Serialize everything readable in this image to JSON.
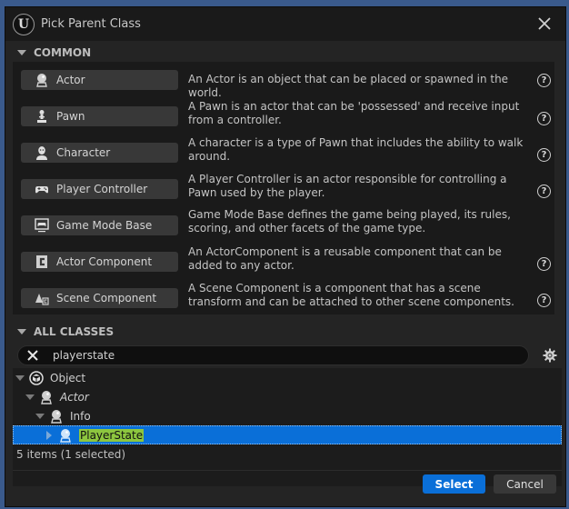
{
  "window": {
    "title": "Pick Parent Class",
    "close_icon": "close-icon"
  },
  "common": {
    "header": "COMMON",
    "items": [
      {
        "label": "Actor",
        "icon": "actor-icon",
        "description": "An Actor is an object that can be placed or spawned in the world.",
        "has_help": true
      },
      {
        "label": "Pawn",
        "icon": "pawn-icon",
        "description": "A Pawn is an actor that can be 'possessed' and receive input from a controller.",
        "has_help": true
      },
      {
        "label": "Character",
        "icon": "character-icon",
        "description": "A character is a type of Pawn that includes the ability to walk around.",
        "has_help": true
      },
      {
        "label": "Player Controller",
        "icon": "gamepad-icon",
        "description": "A Player Controller is an actor responsible for controlling a Pawn used by the player.",
        "has_help": true
      },
      {
        "label": "Game Mode Base",
        "icon": "game-mode-icon",
        "description": "Game Mode Base defines the game being played, its rules, scoring, and other facets of the game type.",
        "has_help": false
      },
      {
        "label": "Actor Component",
        "icon": "actor-component-icon",
        "description": "An ActorComponent is a reusable component that can be added to any actor.",
        "has_help": true
      },
      {
        "label": "Scene Component",
        "icon": "scene-component-icon",
        "description": "A Scene Component is a component that has a scene transform and can be attached to other scene components.",
        "has_help": true
      }
    ]
  },
  "all_classes": {
    "header": "ALL CLASSES",
    "search_value": "playerstate",
    "tree": [
      {
        "label": "Object",
        "depth": 0,
        "expanded": true,
        "italic": false,
        "selected": false,
        "icon": "object-icon"
      },
      {
        "label": "Actor",
        "depth": 1,
        "expanded": true,
        "italic": true,
        "selected": false,
        "icon": "actor-icon"
      },
      {
        "label": "Info",
        "depth": 2,
        "expanded": true,
        "italic": false,
        "selected": false,
        "icon": "actor-icon"
      },
      {
        "label": "PlayerState",
        "depth": 3,
        "expanded": false,
        "italic": false,
        "selected": true,
        "icon": "actor-icon"
      }
    ],
    "status": "5 items (1 selected)"
  },
  "footer": {
    "select_label": "Select",
    "cancel_label": "Cancel"
  },
  "colors": {
    "accent": "#0a6fd8",
    "search_highlight": "#8dc63f",
    "background": "#242424"
  }
}
